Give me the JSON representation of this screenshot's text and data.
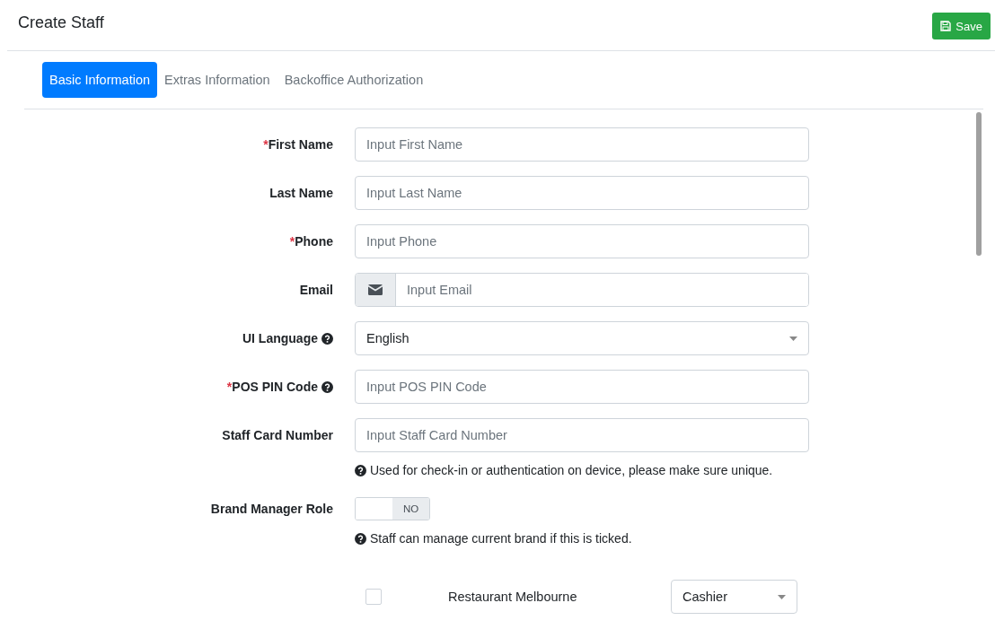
{
  "page_title": "Create Staff",
  "save_button": "Save",
  "tabs": [
    {
      "label": "Basic Information",
      "selected": true
    },
    {
      "label": "Extras Information",
      "selected": false
    },
    {
      "label": "Backoffice Authorization",
      "selected": false
    }
  ],
  "fields": [
    {
      "kind": "text",
      "label": "First Name",
      "required_mark": "*",
      "help_icon": false,
      "placeholder": "Input First Name"
    },
    {
      "kind": "text",
      "label": "Last Name",
      "help_icon": false,
      "placeholder": "Input Last Name"
    },
    {
      "kind": "text",
      "label": "Phone",
      "required_mark": "*",
      "help_icon": false,
      "placeholder": "Input Phone"
    },
    {
      "kind": "email",
      "label": "Email",
      "help_icon": false,
      "placeholder": "Input Email"
    },
    {
      "kind": "select",
      "label": "UI Language",
      "help_icon": true,
      "value": "English"
    },
    {
      "kind": "text",
      "label": "POS PIN Code",
      "required_mark": "*",
      "help_icon": true,
      "placeholder": "Input POS PIN Code"
    },
    {
      "kind": "text",
      "label": "Staff Card Number",
      "help_icon": false,
      "placeholder": "Input Staff Card Number",
      "hint": "Used for check-in or authentication on device, please make sure unique."
    },
    {
      "kind": "toggle",
      "label": "Brand Manager Role",
      "help_icon": false,
      "on": false,
      "toggle_text": "NO",
      "hint": "Staff can manage current brand if this is ticked."
    }
  ],
  "stores": [
    {
      "name": "Restaurant Melbourne",
      "checked": false,
      "role": "Cashier"
    }
  ]
}
